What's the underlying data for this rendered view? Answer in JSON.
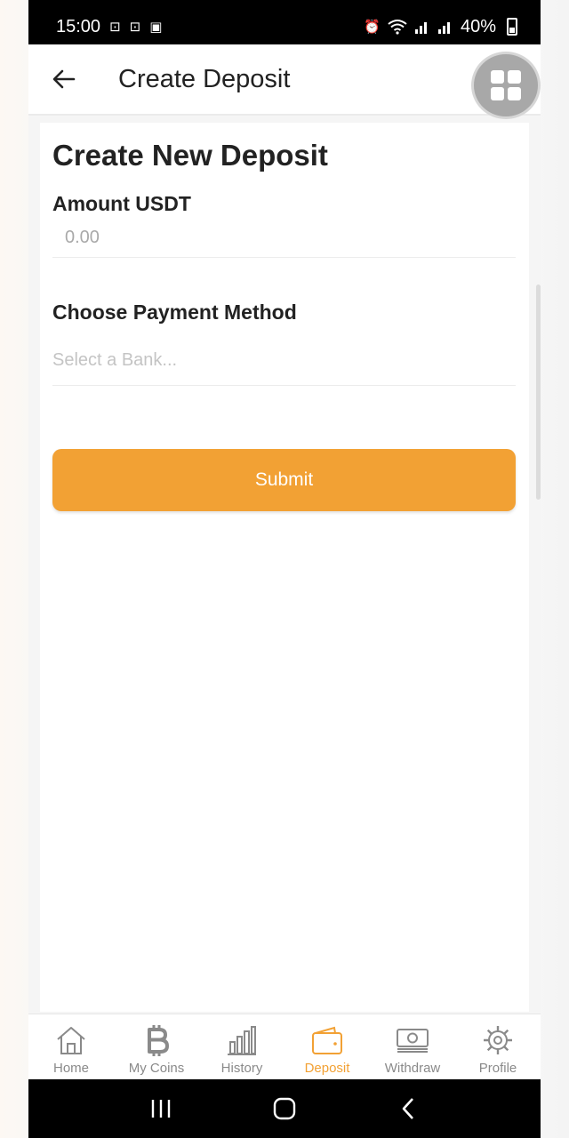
{
  "status_bar": {
    "time": "15:00",
    "battery": "40%"
  },
  "header": {
    "title": "Create Deposit",
    "back_icon": "arrow-left-icon",
    "menu_icon": "grid-icon"
  },
  "form": {
    "title": "Create New Deposit",
    "amount_label": "Amount USDT",
    "amount_placeholder": "0.00",
    "payment_label": "Choose Payment Method",
    "bank_placeholder": "Select a Bank...",
    "submit_label": "Submit"
  },
  "bottom_nav": {
    "items": [
      {
        "label": "Home",
        "icon": "home-icon"
      },
      {
        "label": "My Coins",
        "icon": "bitcoin-icon"
      },
      {
        "label": "History",
        "icon": "bar-chart-icon"
      },
      {
        "label": "Deposit",
        "icon": "wallet-icon"
      },
      {
        "label": "Withdraw",
        "icon": "cash-icon"
      },
      {
        "label": "Profile",
        "icon": "gear-icon"
      }
    ],
    "active": "Deposit"
  },
  "colors": {
    "accent": "#f2a134",
    "inactive": "#8a8a8a"
  }
}
